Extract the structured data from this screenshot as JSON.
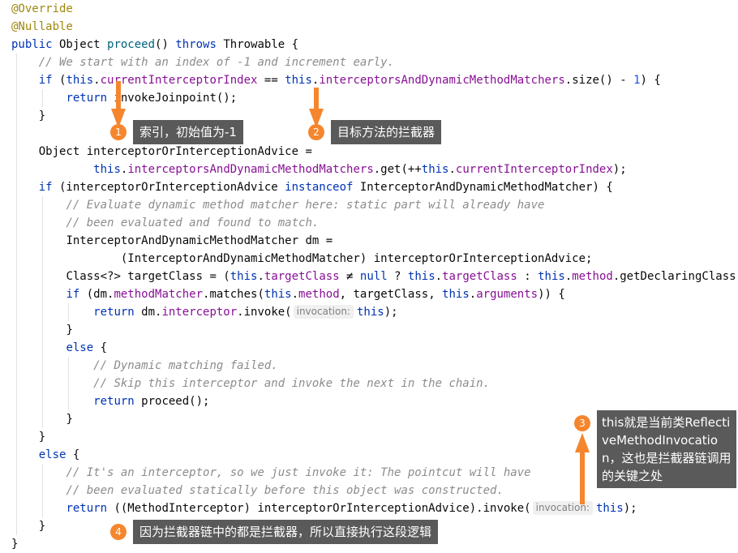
{
  "code": {
    "l1": {
      "t1": "@Override"
    },
    "l2": {
      "t1": "@Nullable"
    },
    "l3": {
      "t1": "public",
      "t2": " Object ",
      "t3": "proceed",
      "t4": "() ",
      "t5": "throws",
      "t6": " Throwable {"
    },
    "l4": {
      "t1": "// We start with an index of -1 and increment early."
    },
    "l5": {
      "t1": "if",
      "t2": " (",
      "t3": "this",
      "t4": ".",
      "t5": "currentInterceptorIndex",
      "t6": " == ",
      "t7": "this",
      "t8": ".",
      "t9": "interceptorsAndDynamicMethodMatchers",
      "t10": ".size() - ",
      "t11": "1",
      "t12": ") {"
    },
    "l6": {
      "t1": "return",
      "t2": " invokeJoinpoint();"
    },
    "l7": {
      "t1": "}"
    },
    "l9": {
      "t1": "Object interceptorOrInterceptionAdvice ="
    },
    "l10": {
      "t1": "this",
      "t2": ".",
      "t3": "interceptorsAndDynamicMethodMatchers",
      "t4": ".get(++",
      "t5": "this",
      "t6": ".",
      "t7": "currentInterceptorIndex",
      "t8": ");"
    },
    "l11": {
      "t1": "if",
      "t2": " (interceptorOrInterceptionAdvice ",
      "t3": "instanceof",
      "t4": " InterceptorAndDynamicMethodMatcher) {"
    },
    "l12": {
      "t1": "// Evaluate dynamic method matcher here: static part will already have"
    },
    "l13": {
      "t1": "// been evaluated and found to match."
    },
    "l14": {
      "t1": "InterceptorAndDynamicMethodMatcher dm ="
    },
    "l15": {
      "t1": "(InterceptorAndDynamicMethodMatcher) interceptorOrInterceptionAdvice;"
    },
    "l16": {
      "t1": "Class<?> targetClass = (",
      "t2": "this",
      "t3": ".",
      "t4": "targetClass",
      "t5": " ≠ ",
      "t6": "null",
      "t7": " ? ",
      "t8": "this",
      "t9": ".",
      "t10": "targetClass",
      "t11": " : ",
      "t12": "this",
      "t13": ".",
      "t14": "method",
      "t15": ".getDeclaringClass());"
    },
    "l17": {
      "t1": "if",
      "t2": " (dm.",
      "t3": "methodMatcher",
      "t4": ".matches(",
      "t5": "this",
      "t6": ".",
      "t7": "method",
      "t8": ", targetClass, ",
      "t9": "this",
      "t10": ".",
      "t11": "arguments",
      "t12": ")) {"
    },
    "l18": {
      "t1": "return",
      "t2": " dm.",
      "t3": "interceptor",
      "t4": ".invoke(",
      "hint": "invocation:",
      "t5": "this",
      "t6": ");"
    },
    "l19": {
      "t1": "}"
    },
    "l20": {
      "t1": "else",
      "t2": " {"
    },
    "l21": {
      "t1": "// Dynamic matching failed."
    },
    "l22": {
      "t1": "// Skip this interceptor and invoke the next in the chain."
    },
    "l23": {
      "t1": "return",
      "t2": " proceed();"
    },
    "l24": {
      "t1": "}"
    },
    "l25": {
      "t1": "}"
    },
    "l26": {
      "t1": "else",
      "t2": " {"
    },
    "l27": {
      "t1": "// It's an interceptor, so we just invoke it: The pointcut will have"
    },
    "l28": {
      "t1": "// been evaluated statically before this object was constructed."
    },
    "l29": {
      "t1": "return",
      "t2": " ((MethodInterceptor) interceptorOrInterceptionAdvice).invoke(",
      "hint": "invocation:",
      "t3": "this",
      "t4": ");"
    },
    "l30": {
      "t1": "}"
    },
    "l31": {
      "t1": "}"
    }
  },
  "annotations": [
    {
      "number": "1",
      "text": "索引，初始值为-1"
    },
    {
      "number": "2",
      "text": "目标方法的拦截器"
    },
    {
      "number": "3",
      "text": "this就是当前类ReflectiveMethodInvocation，这也是拦截器链调用的关键之处"
    },
    {
      "number": "4",
      "text": "因为拦截器链中的都是拦截器，所以直接执行这段逻辑"
    }
  ],
  "colors": {
    "annotation_accent": "#f5862e",
    "annotation_label_bg": "#5a5a5a",
    "keyword": "#0033b3",
    "field": "#871094",
    "method_name": "#00627a",
    "comment": "#8c8c8c",
    "number": "#1750eb",
    "java_annotation": "#9e880d"
  }
}
